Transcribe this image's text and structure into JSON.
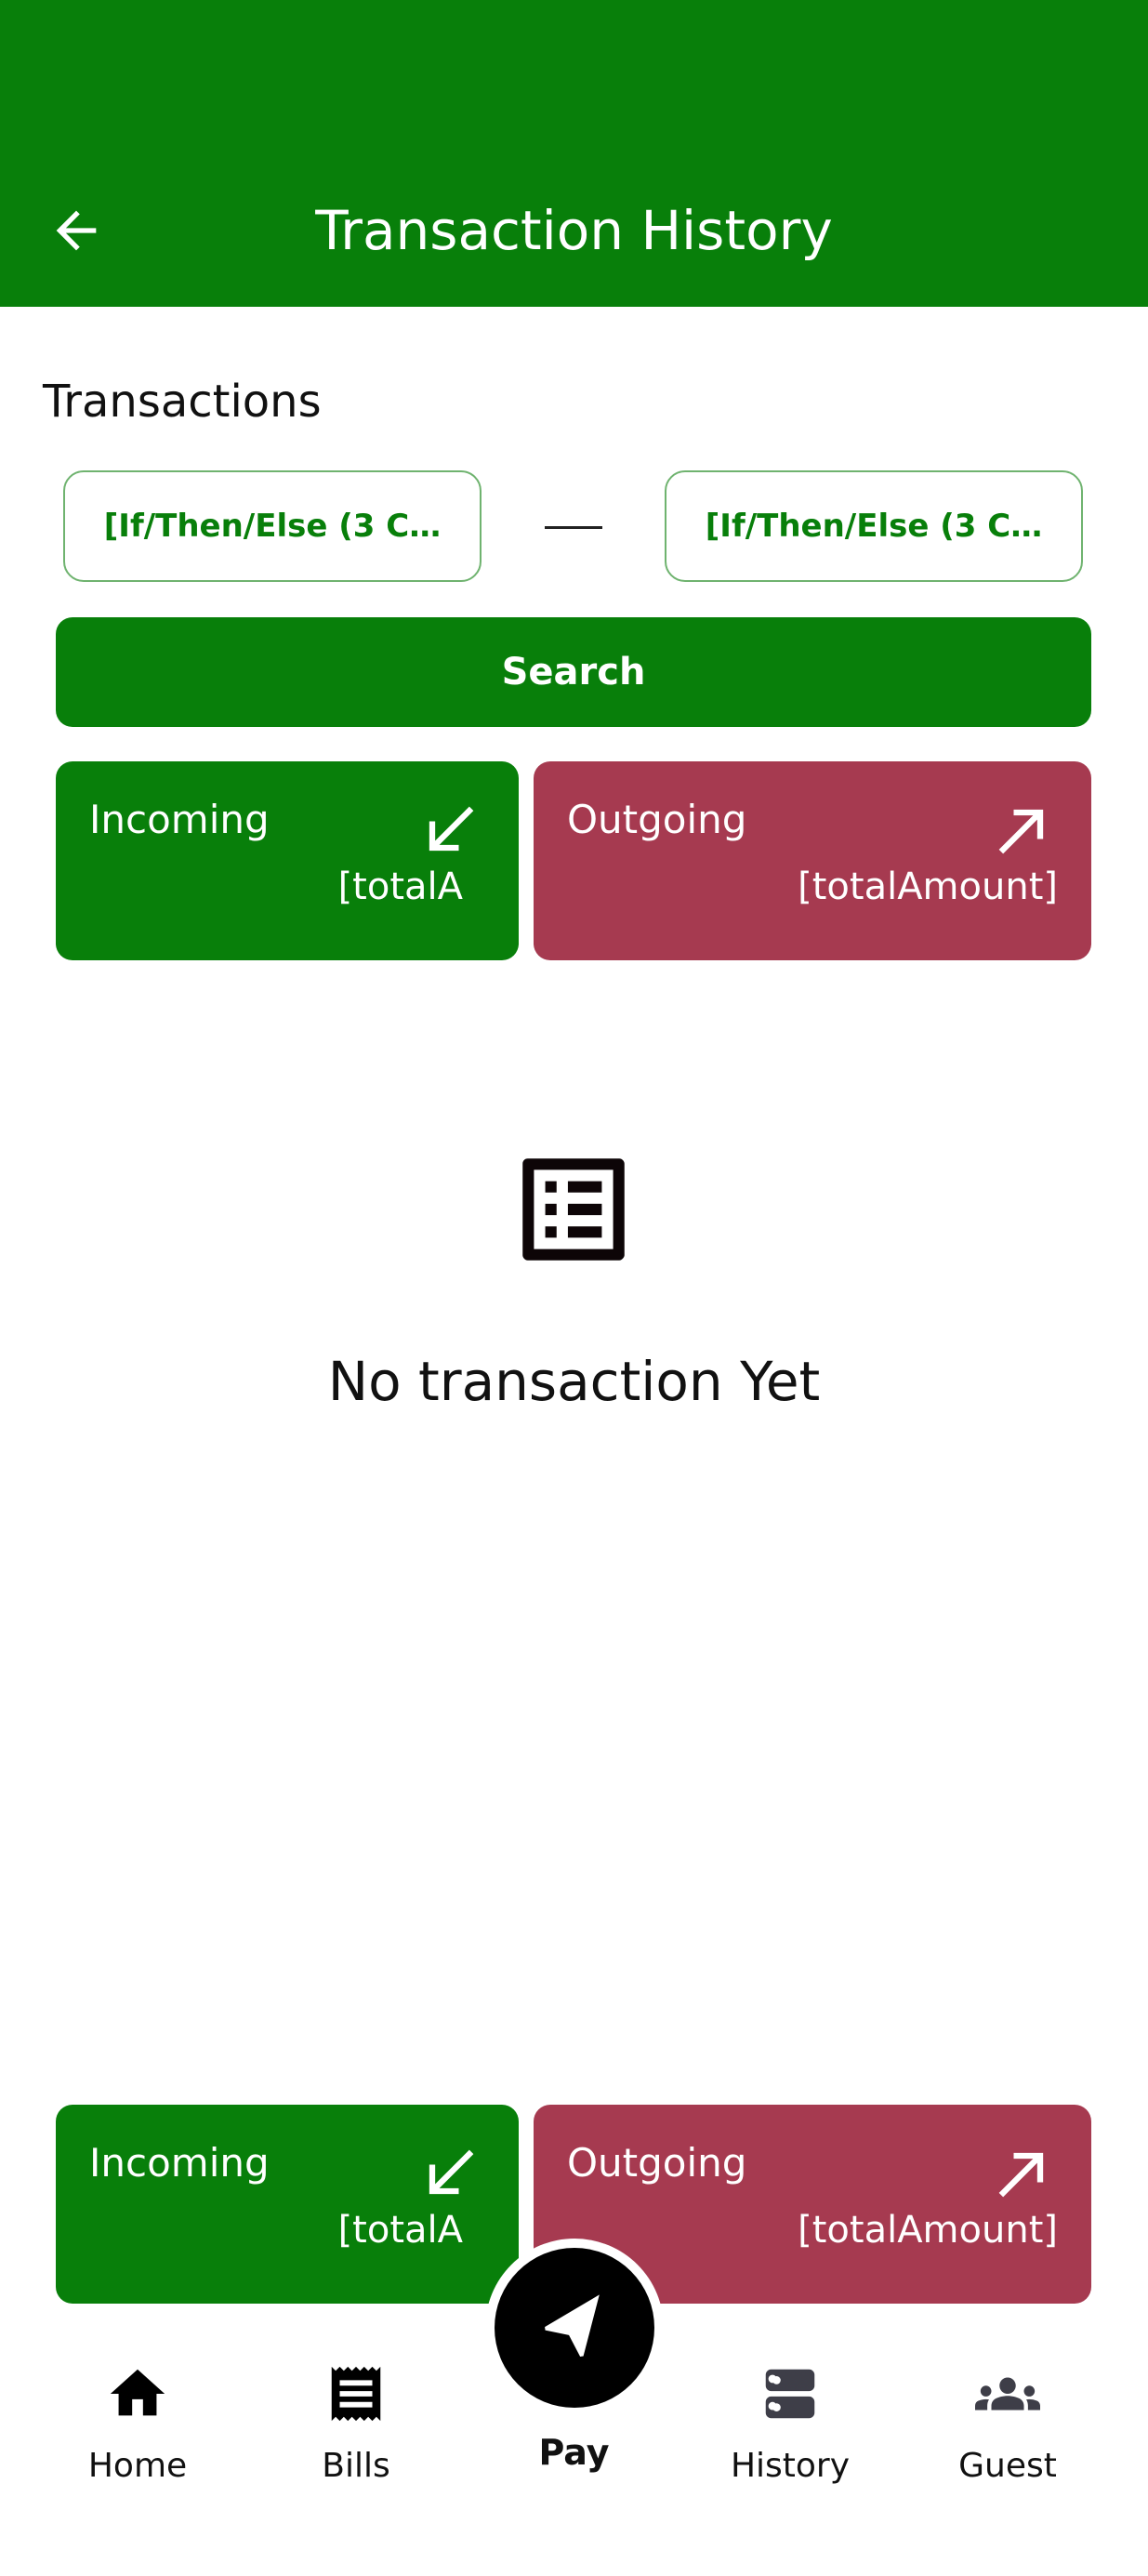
{
  "header": {
    "title": "Transaction History",
    "back_icon": "arrow-back-icon"
  },
  "filters": {
    "section_label": "Transactions",
    "date_from": "[If/Then/Else (3 C…",
    "date_to": "[If/Then/Else (3 C…",
    "search_label": "Search"
  },
  "summary": {
    "incoming_label": "Incoming",
    "incoming_amount": "[totalA",
    "outgoing_label": "Outgoing",
    "outgoing_amount": "[totalAmount]"
  },
  "empty_state": {
    "icon": "list-icon",
    "text": "No transaction Yet"
  },
  "bottom_summary": {
    "incoming_label": "Incoming",
    "incoming_amount": "[totalA",
    "outgoing_label": "Outgoing",
    "outgoing_amount": "[totalAmount]"
  },
  "nav": {
    "items": [
      {
        "label": "Home",
        "icon": "home-icon"
      },
      {
        "label": "Bills",
        "icon": "receipt-icon"
      },
      {
        "label": "Pay",
        "icon": "send-icon"
      },
      {
        "label": "History",
        "icon": "storage-icon"
      },
      {
        "label": "Guest",
        "icon": "group-icon"
      }
    ]
  },
  "colors": {
    "primary": "#087f0a",
    "outgoing": "#a63a50",
    "date_border": "#6fb36f"
  }
}
